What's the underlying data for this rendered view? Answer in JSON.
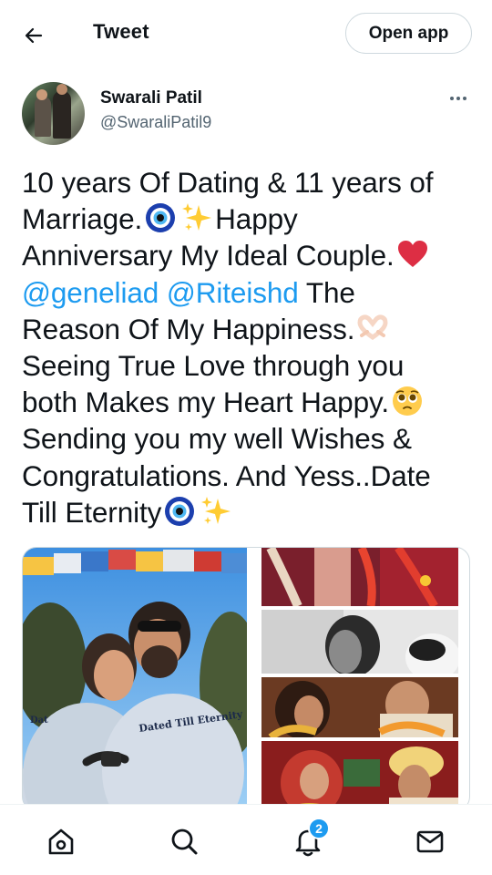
{
  "header": {
    "title": "Tweet",
    "open_app_label": "Open app"
  },
  "author": {
    "name": "Swarali Patil",
    "handle": "@SwaraliPatil9"
  },
  "tweet": {
    "line1": "10 years Of Dating & 11 years of",
    "line2_a": "Marriage.",
    "line2_b": "Happy",
    "line3": "Anniversary My Ideal Couple.",
    "mention1": "@geneliad",
    "mention2": "@Riteishd",
    "line4_tail": " The",
    "line5": "Reason Of My Happiness.",
    "line6": "Seeing True Love through you",
    "line7": "both Makes my Heart Happy.",
    "line8": "Sending you my well Wishes &",
    "line9": "Congratulations. And Yess..Date",
    "line10": "Till Eternity"
  },
  "media": {
    "hoodie_text": "Dated Till Eternity"
  },
  "nav": {
    "notifications_count": "2"
  },
  "colors": {
    "accent": "#1d9bf0",
    "text": "#0f1419",
    "secondary": "#536471",
    "border": "#cfd9de"
  },
  "icons": [
    "back-arrow-icon",
    "more-icon",
    "nazar-amulet-icon",
    "sparkles-icon",
    "red-heart-icon",
    "heart-hands-icon",
    "pleading-face-icon",
    "home-icon",
    "search-icon",
    "bell-icon",
    "mail-icon"
  ]
}
